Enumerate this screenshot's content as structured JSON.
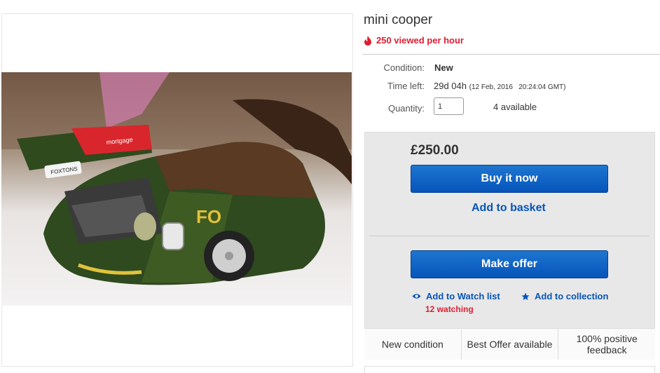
{
  "listing": {
    "title": "mini cooper",
    "views_text": "250 viewed per hour"
  },
  "details": {
    "condition_label": "Condition:",
    "condition_value": "New",
    "time_label": "Time left:",
    "time_value": "29d 04h",
    "time_end": "(12 Feb, 2016   20:24:04 GMT)",
    "quantity_label": "Quantity:",
    "quantity_value": "1",
    "available": "4 available"
  },
  "buy": {
    "price": "£250.00",
    "buy_now": "Buy it now",
    "add_to_basket": "Add to basket",
    "make_offer": "Make offer",
    "watch_list": "Add to Watch list",
    "collection": "Add to collection",
    "watching": "12 watching"
  },
  "features": [
    "New condition",
    "Best Offer available",
    "100% positive feedback"
  ],
  "colors": {
    "accent_red": "#dd1e31",
    "link_blue": "#0654ba",
    "button_blue": "#1e76d0"
  },
  "icons": [
    "flame-icon",
    "eye-icon",
    "star-icon"
  ]
}
